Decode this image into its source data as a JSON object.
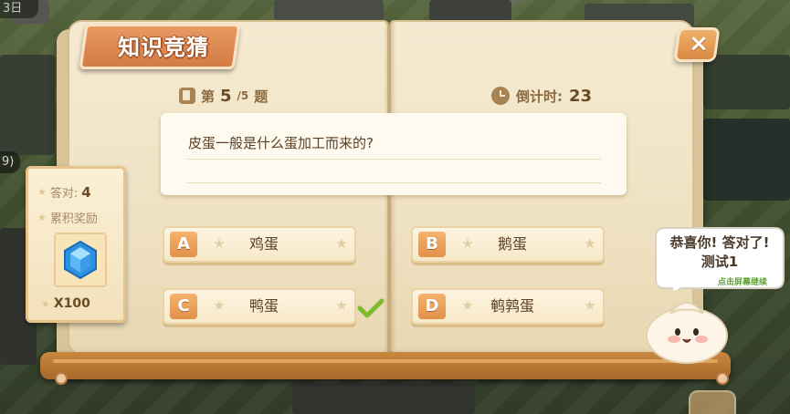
{
  "background": {
    "top_left_badge": "3日",
    "left_badge": "9)"
  },
  "quiz": {
    "title": "知识竞猜",
    "close_icon": "×",
    "question_label_prefix": "第",
    "question_current": "5",
    "question_total": "/5",
    "question_label_suffix": "题",
    "timer_label": "倒计时:",
    "timer_value": "23",
    "question_text": "皮蛋一般是什么蛋加工而来的?",
    "options": [
      {
        "letter": "A",
        "text": "鸡蛋"
      },
      {
        "letter": "B",
        "text": "鹅蛋"
      },
      {
        "letter": "C",
        "text": "鸭蛋"
      },
      {
        "letter": "D",
        "text": "鹌鹑蛋"
      }
    ],
    "correct_option": "C"
  },
  "reward": {
    "correct_label": "答对:",
    "correct_count": "4",
    "accumulated_label": "累积奖励",
    "gem_icon": "blue-gem-icon",
    "reward_amount": "X100"
  },
  "mascot": {
    "message": "恭喜你! 答对了!测试1",
    "hint": "点击屏幕继续"
  },
  "colors": {
    "accent_orange": "#e1914a",
    "page_paper": "#f5ead1",
    "check_green": "#7dbb2f",
    "gem_blue": "#2f8fe0"
  }
}
